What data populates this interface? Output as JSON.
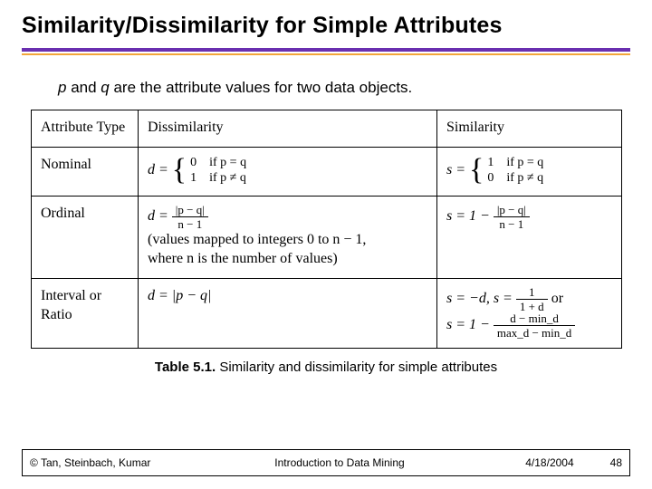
{
  "title": "Similarity/Dissimilarity for Simple Attributes",
  "intro": {
    "p": "p",
    "mid1": " and ",
    "q": "q",
    "tail": " are the attribute values for two data objects."
  },
  "table": {
    "headers": {
      "c0": "Attribute Type",
      "c1": "Dissimilarity",
      "c2": "Similarity"
    },
    "rows": {
      "nominal": {
        "label": "Nominal",
        "d_pre": "d = ",
        "d_line1": "0 if p = q",
        "d_line2": "1 if p ≠ q",
        "s_pre": "s = ",
        "s_line1": "1 if p = q",
        "s_line2": "0 if p ≠ q"
      },
      "ordinal": {
        "label": "Ordinal",
        "d_pre": "d = ",
        "d_num": "|p − q|",
        "d_den": "n − 1",
        "note1": "(values mapped to integers 0 to n − 1,",
        "note2": "where n is the number of values)",
        "s_pre": "s = 1 − ",
        "s_num": "|p − q|",
        "s_den": "n − 1"
      },
      "ratio": {
        "label": "Interval or Ratio",
        "d": "d = |p − q|",
        "s1_pre": "s = −d, s = ",
        "s1_num": "1",
        "s1_den": "1 + d",
        "s1_or": " or",
        "s2_pre": "s = 1 − ",
        "s2_num": "d − min_d",
        "s2_den": "max_d − min_d"
      }
    }
  },
  "caption": {
    "bold": "Table 5.1.",
    "rest": " Similarity and dissimilarity for simple attributes"
  },
  "footer": {
    "left": "© Tan, Steinbach, Kumar",
    "mid": "Introduction to Data Mining",
    "date": "4/18/2004",
    "page": "48"
  }
}
